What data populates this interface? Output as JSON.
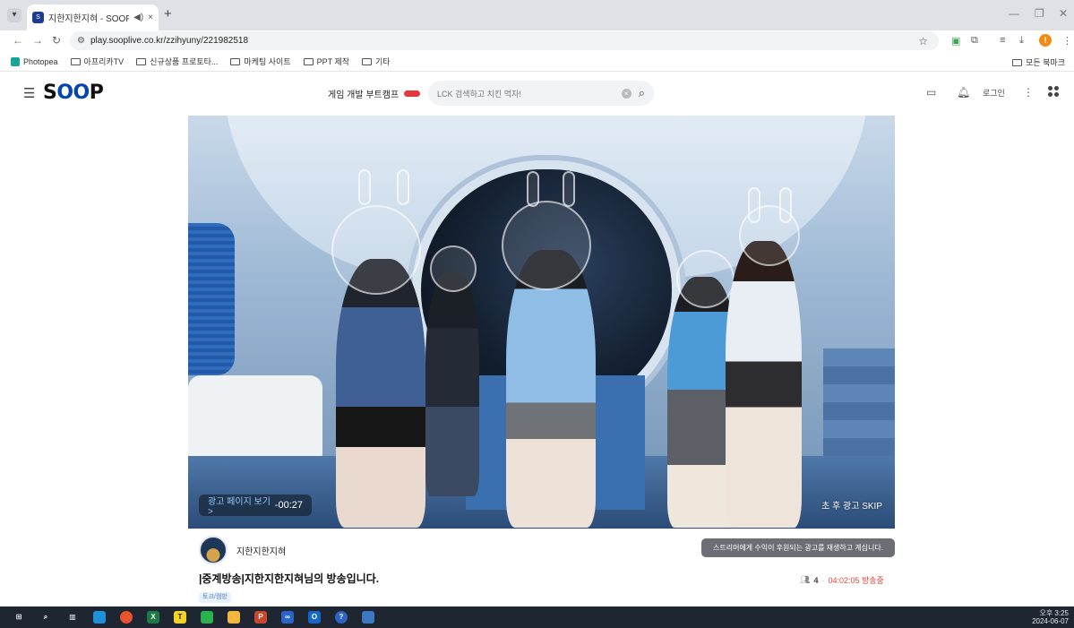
{
  "browser": {
    "tab_title": "지한지한지혀 - SOOP",
    "tab_audio_icon": "speaker-icon",
    "tab_close": "×",
    "new_tab": "+",
    "url": "play.sooplive.co.kr/zzihyuny/221982518",
    "bookmarks": [
      "Photopea",
      "아프리카TV",
      "신규상품 프로토타...",
      "마케팅 사이트",
      "PPT 제작",
      "기타"
    ],
    "bookmarks_right": "모든 북마크"
  },
  "soop": {
    "logo_s": "S",
    "logo_oo": "OO",
    "logo_p": "P",
    "promo_text": "게임 개발 부트캠프",
    "search_placeholder": "LCK 검색하고 치킨 먹자!",
    "login": "로그인"
  },
  "player": {
    "ad_link": "광고 페이지 보기 >",
    "ad_time": "-00:27",
    "ad_skip": "초 후 광고 SKIP"
  },
  "broadcast": {
    "streamer_name": "지한지한지혀",
    "donation_notice": "스트리머에게 수익이 후원되는 광고를 재생하고 계십니다.",
    "title": "|중계방송|지한지한지혀님의 방송입니다.",
    "viewer_count": "4",
    "separator": "·",
    "elapsed": "04:02:05 방송중",
    "tag": "토크/캠방"
  },
  "taskbar": {
    "time": "오후 3:25",
    "date": "2024-06-07"
  },
  "colors": {
    "soop_blue": "#0545b1",
    "live_red": "#e5473f",
    "taskbar": "#1d2631"
  }
}
